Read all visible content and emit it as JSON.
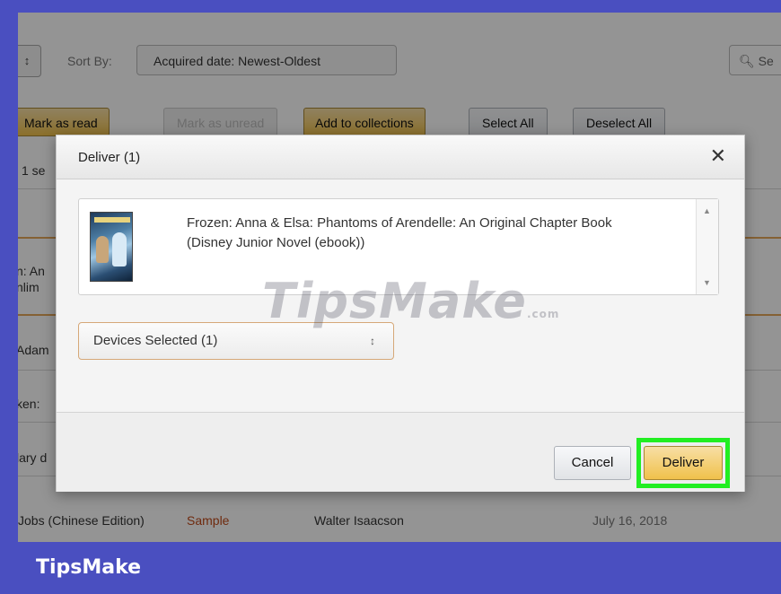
{
  "background": {
    "small_select_glyph": "↕",
    "sort_by_label": "Sort By:",
    "sort_select_value": "Acquired date: Newest-Oldest",
    "search_placeholder": "Se",
    "buttons": {
      "mark_as_read": "Mark as read",
      "mark_as_unread": "Mark as unread",
      "add_to_collections": "Add to collections",
      "select_all": "Select All",
      "deselect_all": "Deselect All"
    },
    "selected_count": "1 se",
    "row_fragments": [
      "n: An",
      "nlim",
      "Adam",
      "ken:",
      "lary d"
    ],
    "last_row": {
      "title": "Jobs (Chinese Edition)",
      "badge": "Sample",
      "author": "Walter Isaacson",
      "date": "July 16, 2018"
    }
  },
  "dialog": {
    "title": "Deliver (1)",
    "close_glyph": "✕",
    "item_title": "Frozen: Anna & Elsa: Phantoms of Arendelle: An Original Chapter Book (Disney Junior Novel (ebook))",
    "device_select_value": "Devices Selected (1)",
    "device_select_arrow": "↕",
    "cancel_label": "Cancel",
    "deliver_label": "Deliver"
  },
  "watermark": {
    "main": "TipsMake",
    "suffix": ".com"
  },
  "brand": "TipsMake",
  "colors": {
    "accent": "#f0c14b",
    "highlight": "#22ee22",
    "frame": "#4a4fc0"
  }
}
